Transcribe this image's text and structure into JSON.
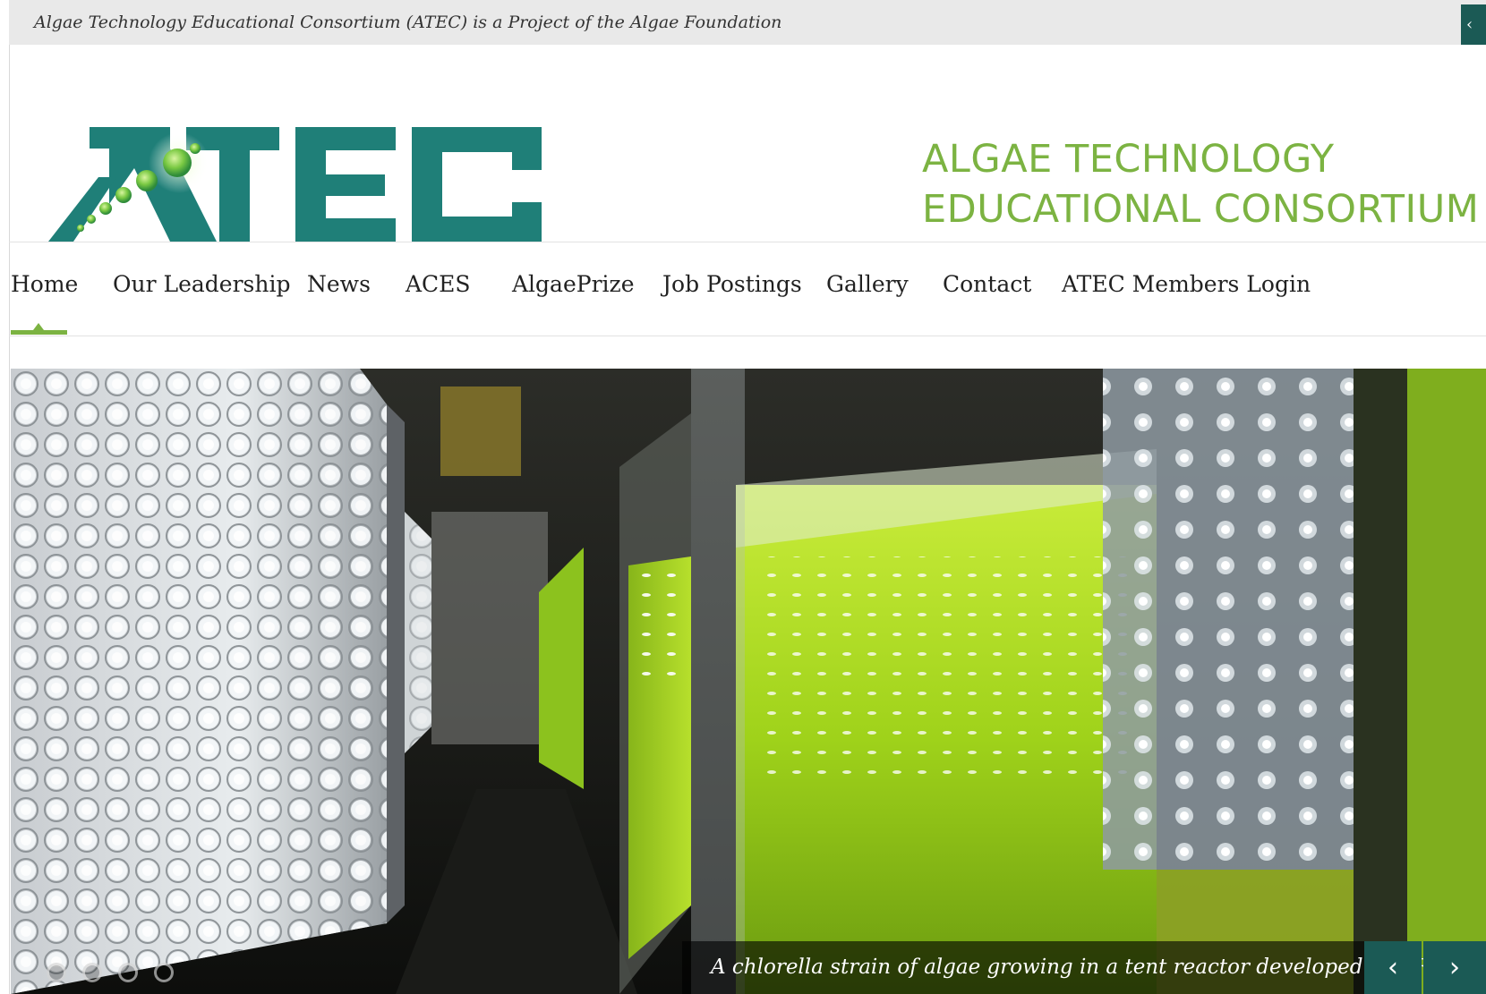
{
  "topbar": {
    "text": "Algae Technology Educational Consortium (ATEC) is a Project of the Algae Foundation",
    "tab_icon": "‹"
  },
  "header": {
    "logo_text": "ATEC",
    "tagline_line1": "ALGAE TECHNOLOGY",
    "tagline_line2": "EDUCATIONAL CONSORTIUM"
  },
  "nav": {
    "items": [
      {
        "label": "Home"
      },
      {
        "label": "Our Leadership"
      },
      {
        "label": "News"
      },
      {
        "label": "ACES"
      },
      {
        "label": "AlgaePrize"
      },
      {
        "label": "Job Postings"
      },
      {
        "label": "Gallery"
      },
      {
        "label": "Contact"
      },
      {
        "label": "ATEC Members Login"
      }
    ],
    "active": "Home"
  },
  "slider": {
    "caption": "A chlorella strain of algae growing in a tent reactor developed at NREL",
    "prev_icon": "‹",
    "next_icon": "›",
    "dot_count": 4
  },
  "colors": {
    "brand_teal": "#1f7f78",
    "accent_green": "#7cb342",
    "button_teal": "#1b5a55"
  }
}
